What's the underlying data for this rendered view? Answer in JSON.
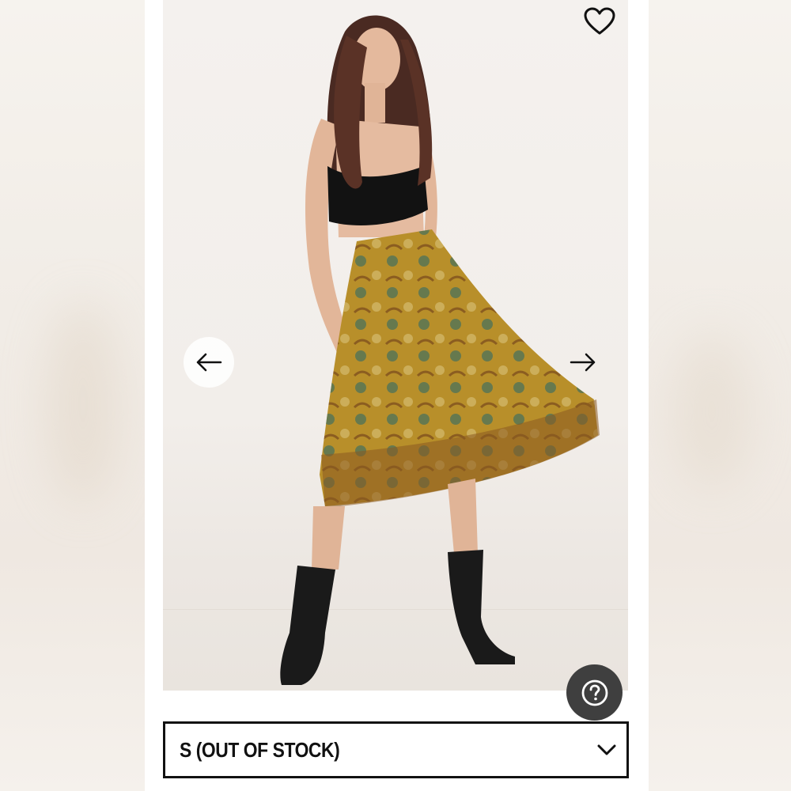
{
  "product": {
    "image_alt": "Model wearing black velvet crop top, patterned mustard midi skirt and black ankle boots"
  },
  "controls": {
    "wishlist_icon": "heart-outline-icon",
    "prev_icon": "arrow-left-icon",
    "next_icon": "arrow-right-icon",
    "help_icon": "question-circle-icon"
  },
  "size_select": {
    "selected": "S (OUT OF STOCK)",
    "icon": "chevron-down-icon"
  },
  "colors": {
    "background": "#ffffff",
    "border": "#111111",
    "help_button": "#3f3f3f"
  }
}
